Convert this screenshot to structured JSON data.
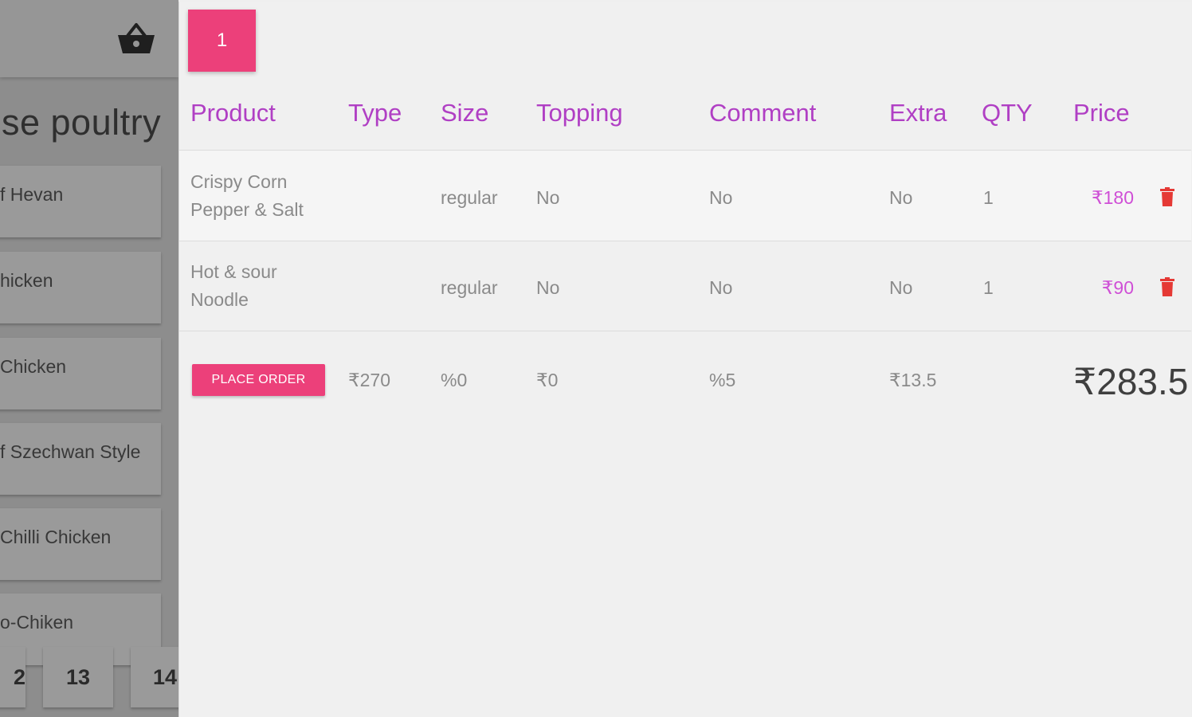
{
  "category": {
    "title": "se poultry",
    "items": [
      "f Hevan",
      "hicken",
      "Chicken",
      "f Szechwan Style",
      "Chilli Chicken",
      "o-Chiken"
    ]
  },
  "pagination": [
    "2",
    "13",
    "14"
  ],
  "table_tab": {
    "label": "1"
  },
  "columns": {
    "product": "Product",
    "type": "Type",
    "size": "Size",
    "topping": "Topping",
    "comment": "Comment",
    "extra": "Extra",
    "qty": "QTY",
    "price": "Price"
  },
  "rows": [
    {
      "product": "Crispy Corn Pepper & Salt",
      "type": "",
      "size": "regular",
      "topping": "No",
      "comment": "No",
      "extra": "No",
      "qty": "1",
      "price": "₹180"
    },
    {
      "product": "Hot & sour Noodle",
      "type": "",
      "size": "regular",
      "topping": "No",
      "comment": "No",
      "extra": "No",
      "qty": "1",
      "price": "₹90"
    }
  ],
  "totals": {
    "place_order_label": "PLACE ORDER",
    "subtotal": "₹270",
    "size_value": "%0",
    "topping_value": "₹0",
    "comment_value": "%5",
    "extra_value": "₹13.5",
    "grand_total": "₹283.5"
  },
  "colors": {
    "accent": "#ec407a",
    "header_text": "#b03fc4",
    "price_text": "#cf4fd6",
    "trash": "#e53935"
  },
  "icons": {
    "basket": "basket-icon",
    "delete": "trash-icon"
  }
}
